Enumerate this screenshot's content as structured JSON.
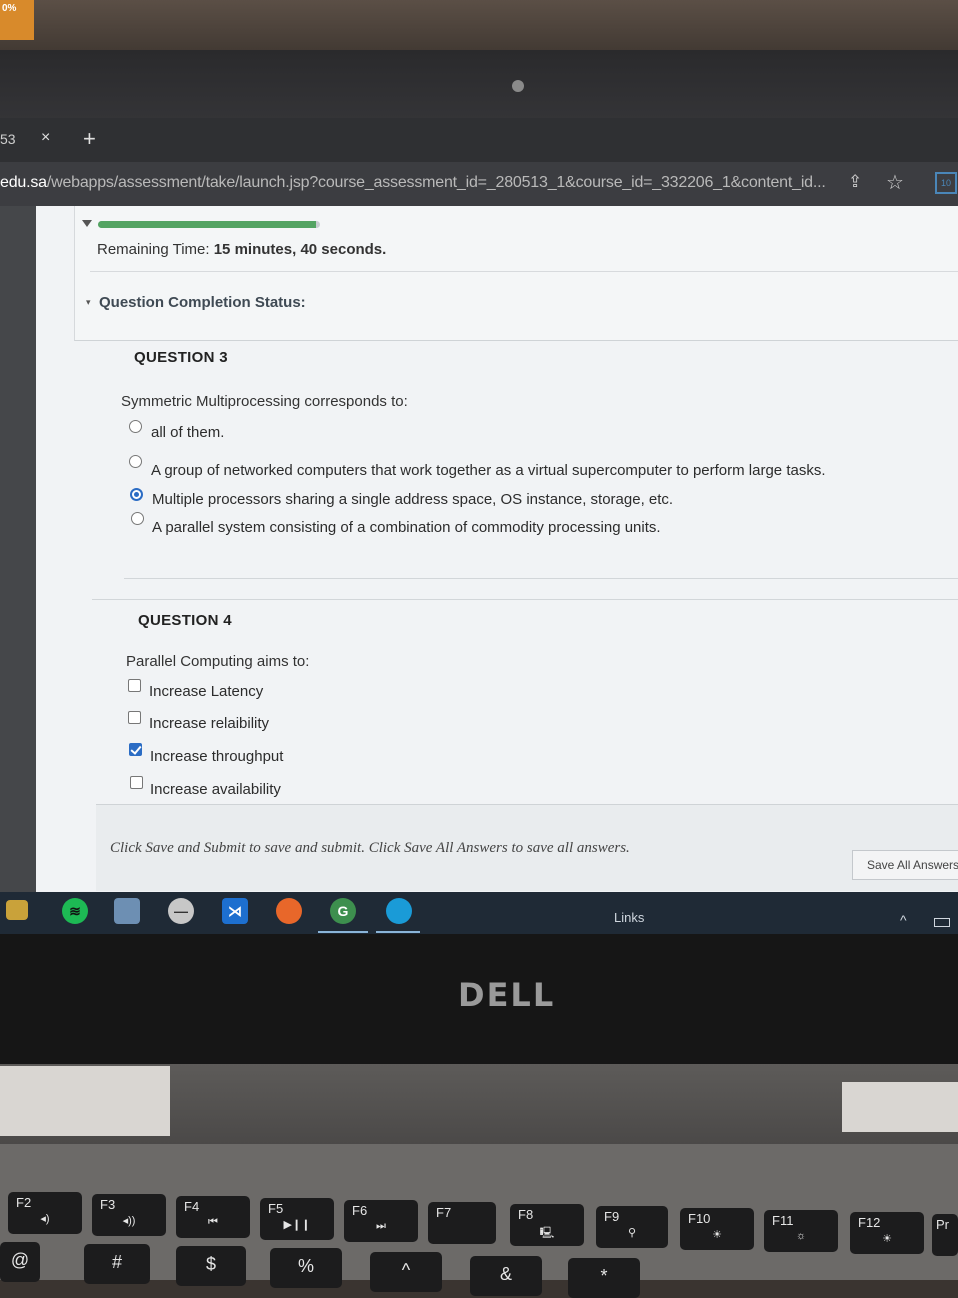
{
  "wall_badge": "0%",
  "browser": {
    "tab_count_partial": "53",
    "tab_close": "×",
    "new_tab": "+",
    "url_host": "edu.sa",
    "url_path": "/webapps/assessment/take/launch.jsp?course_assessment_id=_280513_1&course_id=_332206_1&content_id...",
    "extension_badge": "10"
  },
  "assessment": {
    "progress_fraction": 0.98,
    "remaining_label": "Remaining Time:",
    "remaining_minutes": "15",
    "minutes_word": "minutes,",
    "remaining_seconds": "40",
    "seconds_word": "seconds.",
    "completion_status": "Question Completion Status:"
  },
  "question3": {
    "title": "QUESTION 3",
    "text": "Symmetric Multiprocessing corresponds to:",
    "options": [
      {
        "label": "all of them.",
        "selected": false
      },
      {
        "label": "A group of networked computers that work together as a virtual supercomputer to perform large tasks.",
        "selected": false
      },
      {
        "label": "Multiple processors sharing a single address space, OS instance, storage, etc.",
        "selected": true
      },
      {
        "label": "A parallel system consisting of a combination of commodity processing units.",
        "selected": false
      }
    ]
  },
  "question4": {
    "title": "QUESTION 4",
    "text": "Parallel Computing aims to:",
    "options": [
      {
        "label": "Increase Latency",
        "checked": false
      },
      {
        "label": "Increase relaibility",
        "checked": false
      },
      {
        "label": "Increase throughput",
        "checked": true
      },
      {
        "label": "Increase availability",
        "checked": false
      }
    ]
  },
  "footer": {
    "instruction": "Click Save and Submit to save and submit. Click Save All Answers to save all answers.",
    "save_all_label": "Save All Answers"
  },
  "taskbar": {
    "links_label": "Links",
    "chevron": "^"
  },
  "laptop": {
    "brand": "DELL",
    "fkeys": [
      {
        "label": "F2",
        "sub": "◂)"
      },
      {
        "label": "F3",
        "sub": "◂))"
      },
      {
        "label": "F4",
        "sub": "⏮"
      },
      {
        "label": "F5",
        "sub": "▶❙❙"
      },
      {
        "label": "F6",
        "sub": "⏭"
      },
      {
        "label": "F7",
        "sub": ""
      },
      {
        "label": "F8",
        "sub": "🖳"
      },
      {
        "label": "F9",
        "sub": "⚲"
      },
      {
        "label": "F10",
        "sub": "☀"
      },
      {
        "label": "F11",
        "sub": "☼"
      },
      {
        "label": "F12",
        "sub": "☀"
      },
      {
        "label": "Pr",
        "sub": ""
      }
    ],
    "numkeys": [
      "@",
      "#",
      "$",
      "%",
      "^",
      "&",
      "*"
    ]
  }
}
